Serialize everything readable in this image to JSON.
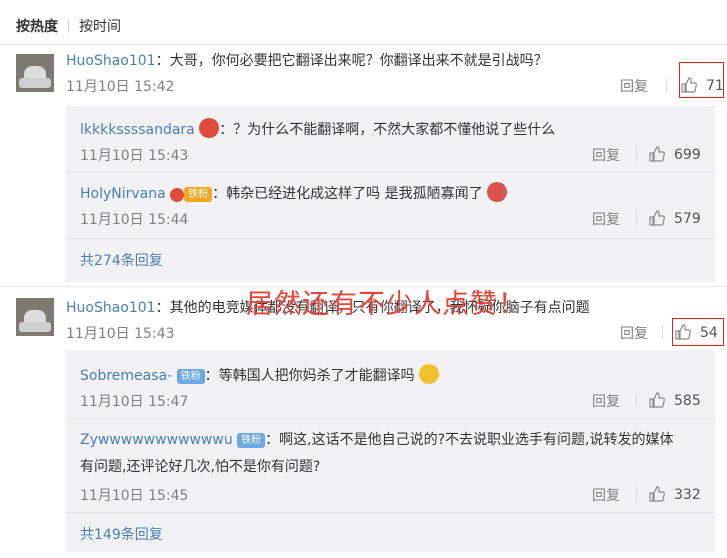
{
  "sort": {
    "active": "按热度",
    "other": "按时间"
  },
  "threads": [
    {
      "user": "HuoShao101",
      "text": "：大哥，你何必要把它翻译出来呢？你翻译出来不就是引战吗？",
      "time": "11月10日 15:42",
      "reply": "回复",
      "likes": "71",
      "replies": [
        {
          "user": "lkkkkssssandara",
          "text": "：？为什么不能翻译啊，不然大家都不懂他说了些什么",
          "time": "11月10日 15:43",
          "reply": "回复",
          "likes": "699"
        },
        {
          "user": "HolyNirvana",
          "badge": "铁粉",
          "text": "：韩杂已经进化成这样了吗 是我孤陋寡闻了",
          "time": "11月10日 15:44",
          "reply": "回复",
          "likes": "579"
        }
      ],
      "more": "共274条回复"
    },
    {
      "user": "HuoShao101",
      "text": "：其他的电竞媒体都没有翻译，只有你翻译了，我怀疑你脑子有点问题",
      "time": "11月10日 15:43",
      "reply": "回复",
      "likes": "54",
      "replies": [
        {
          "user": "Sobremeasa-",
          "badge": "铁粉",
          "text": "：等韩国人把你妈杀了才能翻译吗",
          "time": "11月10日 15:47",
          "reply": "回复",
          "likes": "585"
        },
        {
          "user": "Zywwwwwwwwwwwu",
          "badge": "铁粉",
          "text_line1": "：啊这,这话不是他自己说的?不去说职业选手有问题,说转发的媒体",
          "text_line2": "有问题,还评论好几次,怕不是你有问题?",
          "time": "11月10日 15:45",
          "reply": "回复",
          "likes": "332"
        }
      ],
      "more": "共149条回复"
    }
  ],
  "overlay_text": "居然还有不少人点赞！",
  "colors": {
    "link": "#4a7fb5",
    "overlay": "#e8453a",
    "highlight_box": "#e0231c"
  }
}
